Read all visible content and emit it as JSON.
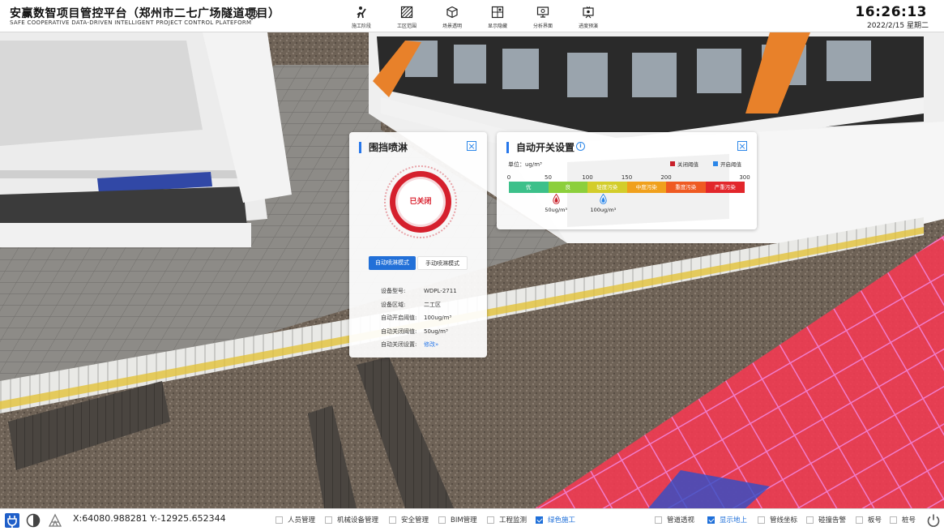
{
  "header": {
    "title": "安赢数智项目管控平台（郑州市二七广场隧道项目）",
    "subtitle": "SAFE COOPERATIVE DATA-DRIVEN INTELLIGENT PROJECT CONTROL PLATEFORM",
    "settings_icon": "gear-icon",
    "nav": [
      {
        "label": "施工阶段",
        "icon": "worker-icon"
      },
      {
        "label": "工区范围",
        "icon": "hatch-area-icon"
      },
      {
        "label": "场景透明",
        "icon": "cube-icon"
      },
      {
        "label": "显示隐藏",
        "icon": "grid-toggle-icon"
      },
      {
        "label": "分析界面",
        "icon": "monitor-icon"
      },
      {
        "label": "进度预演",
        "icon": "progress-icon"
      }
    ],
    "time": "16:26:13",
    "date": "2022/2/15 星期二"
  },
  "spray_panel": {
    "title": "围挡喷淋",
    "status": "已关闭",
    "mode_auto": "自动喷淋模式",
    "mode_manual": "手动喷淋模式",
    "rows": [
      {
        "label": "设备型号:",
        "value": "WDPL-2711"
      },
      {
        "label": "设备区域:",
        "value": "二工区"
      },
      {
        "label": "自动开启阈值:",
        "value": "100ug/m³"
      },
      {
        "label": "自动关闭阈值:",
        "value": "50ug/m³"
      },
      {
        "label": "自动关闭设置:",
        "value": "修改»"
      }
    ]
  },
  "auto_panel": {
    "title": "自动开关设置",
    "unit": "单位：ug/m³",
    "legend_close": "关闭阈值",
    "legend_open": "开启阈值",
    "ticks": [
      "0",
      "50",
      "100",
      "150",
      "200",
      "300"
    ],
    "scale_max": 300,
    "segments": [
      {
        "label": "优",
        "color": "#3cc08a"
      },
      {
        "label": "良",
        "color": "#8ccf3c"
      },
      {
        "label": "轻度污染",
        "color": "#d3cd2a"
      },
      {
        "label": "中度污染",
        "color": "#f0a01c"
      },
      {
        "label": "重度污染",
        "color": "#ef5a22"
      },
      {
        "label": "严重污染",
        "color": "#e2262b"
      }
    ],
    "close_threshold": {
      "value": 50,
      "label": "50ug/m³"
    },
    "open_threshold": {
      "value": 100,
      "label": "100ug/m³"
    }
  },
  "footer": {
    "coords": "X:64080.988281  Y:-12925.652344",
    "checks": [
      {
        "label": "人员管理",
        "checked": false
      },
      {
        "label": "机械设备管理",
        "checked": false
      },
      {
        "label": "安全管理",
        "checked": false
      },
      {
        "label": "BIM管理",
        "checked": false
      },
      {
        "label": "工程监测",
        "checked": false
      },
      {
        "label": "绿色施工",
        "checked": true
      },
      {
        "label": "管道透视",
        "checked": false
      },
      {
        "label": "显示地上",
        "checked": true
      },
      {
        "label": "管线坐标",
        "checked": false
      },
      {
        "label": "碰撞告警",
        "checked": false
      },
      {
        "label": "板号",
        "checked": false
      },
      {
        "label": "桩号",
        "checked": false
      }
    ]
  },
  "colors": {
    "accent": "#2270d8",
    "status_red": "#d91e2c",
    "close_marker": "#c8202a",
    "open_marker": "#2b86e8"
  }
}
